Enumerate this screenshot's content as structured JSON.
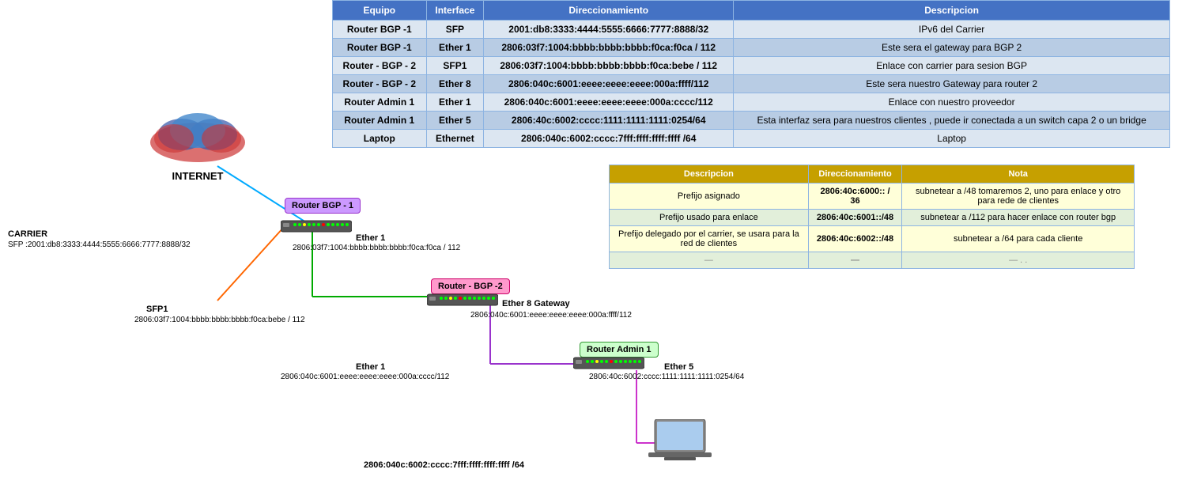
{
  "table": {
    "headers": [
      "Equipo",
      "Interface",
      "Direccionamiento",
      "Descripcion"
    ],
    "rows": [
      {
        "equipo": "Router BGP -1",
        "interface": "SFP",
        "direccionamiento": "2001:db8:3333:4444:5555:6666:7777:8888/32",
        "descripcion": "IPv6 del Carrier"
      },
      {
        "equipo": "Router BGP -1",
        "interface": "Ether 1",
        "direccionamiento": "2806:03f7:1004:bbbb:bbbb:bbbb:f0ca:f0ca / 112",
        "descripcion": "Este sera el gateway para BGP 2"
      },
      {
        "equipo": "Router - BGP - 2",
        "interface": "SFP1",
        "direccionamiento": "2806:03f7:1004:bbbb:bbbb:bbbb:f0ca:bebe / 112",
        "descripcion": "Enlace con carrier para sesion BGP"
      },
      {
        "equipo": "Router - BGP - 2",
        "interface": "Ether 8",
        "direccionamiento": "2806:040c:6001:eeee:eeee:eeee:000a:ffff/112",
        "descripcion": "Este sera nuestro Gateway para router 2"
      },
      {
        "equipo": "Router Admin 1",
        "interface": "Ether 1",
        "direccionamiento": "2806:040c:6001:eeee:eeee:eeee:000a:cccc/112",
        "descripcion": "Enlace con nuestro proveedor"
      },
      {
        "equipo": "Router Admin 1",
        "interface": "Ether 5",
        "direccionamiento": "2806:40c:6002:cccc:1111:1111:1111:0254/64",
        "descripcion": "Esta interfaz sera para nuestros clientes , puede ir conectada a un switch capa 2 o un bridge"
      },
      {
        "equipo": "Laptop",
        "interface": "Ethernet",
        "direccionamiento": "2806:040c:6002:cccc:7fff:ffff:ffff:ffff /64",
        "descripcion": "Laptop"
      }
    ]
  },
  "secondary_table": {
    "headers": [
      "Descripcion",
      "Direccionamiento",
      "Nota"
    ],
    "rows": [
      {
        "descripcion": "Prefijo asignado",
        "direccionamiento": "2806:40c:6000:: / 36",
        "nota": "subnetear a /48  tomaremos 2, uno para enlace y otro para rede de clientes"
      },
      {
        "descripcion": "Prefijo usado para enlace",
        "direccionamiento": "2806:40c:6001::/48",
        "nota": "subnetear a /112 para hacer enlace con router bgp"
      },
      {
        "descripcion": "Prefijo delegado por el carrier, se usara para la red de clientes",
        "direccionamiento": "2806:40c:6002::/48",
        "nota": "subnetear a /64 para cada cliente"
      },
      {
        "descripcion": "—",
        "direccionamiento": "—",
        "nota": "— . ."
      }
    ]
  },
  "diagram": {
    "internet_label": "INTERNET",
    "carrier_label": "CARRIER",
    "carrier_sfp": "SFP :2001:db8:3333:4444:5555:6666:7777:8888/32",
    "router_bgp1_label": "Router BGP -\n1",
    "router_bgp2_label": "Router - BGP -2",
    "router_admin1_label": "Router Admin 1",
    "ether1_bgp1": "Ether 1",
    "ether1_bgp1_addr": "2806:03f7:1004:bbbb:bbbb:bbbb:f0ca:f0ca / 112",
    "sfp1_label": "SFP1",
    "sfp1_addr": "2806:03f7:1004:bbbb:bbbb:bbbb:f0ca:bebe / 112",
    "ether8_label": "Ether 8 Gateway",
    "ether8_addr": "2806:040c:6001:eeee:eeee:eeee:000a:ffff/112",
    "ether1_admin1": "Ether 1",
    "ether1_admin1_addr": "2806:040c:6001:eeee:eeee:eeee:000a:cccc/112",
    "ether5_label": "Ether 5",
    "ether5_addr": "2806:40c:6002:cccc:1111:1111:1111:0254/64",
    "laptop_addr": "2806:040c:6002:cccc:7fff:ffff:ffff:ffff /64"
  }
}
